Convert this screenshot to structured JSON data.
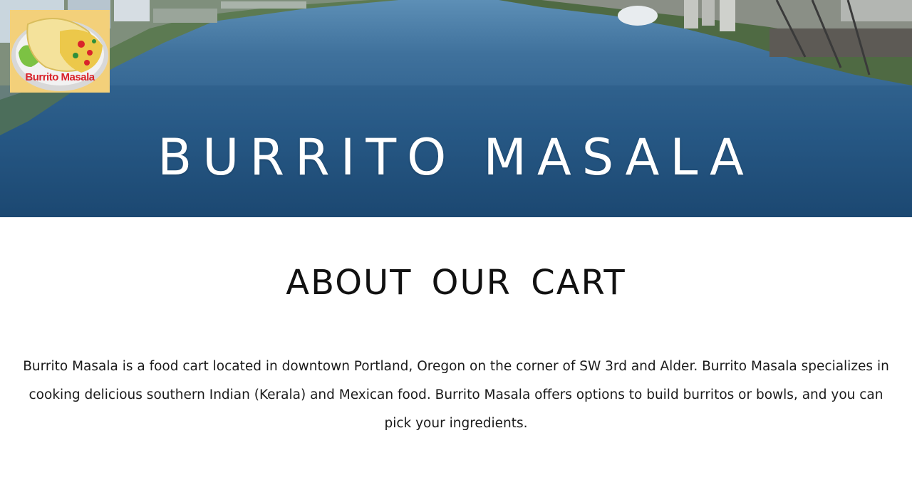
{
  "header": {
    "logo": {
      "text": "Burrito Masala",
      "icon": "burrito-plate-icon",
      "background": "#f3d07a",
      "text_color": "#d9242b"
    },
    "title": "BURRITO MASALA",
    "background_image": "river-city-aerial"
  },
  "about": {
    "heading": "ABOUT OUR CART",
    "body": "Burrito Masala is a food cart located in downtown Portland, Oregon on the corner of SW 3rd and Alder. Burrito Masala specializes in cooking delicious southern Indian (Kerala) and Mexican food. Burrito Masala offers options to build burritos or bowls, and you can pick your ingredients."
  }
}
